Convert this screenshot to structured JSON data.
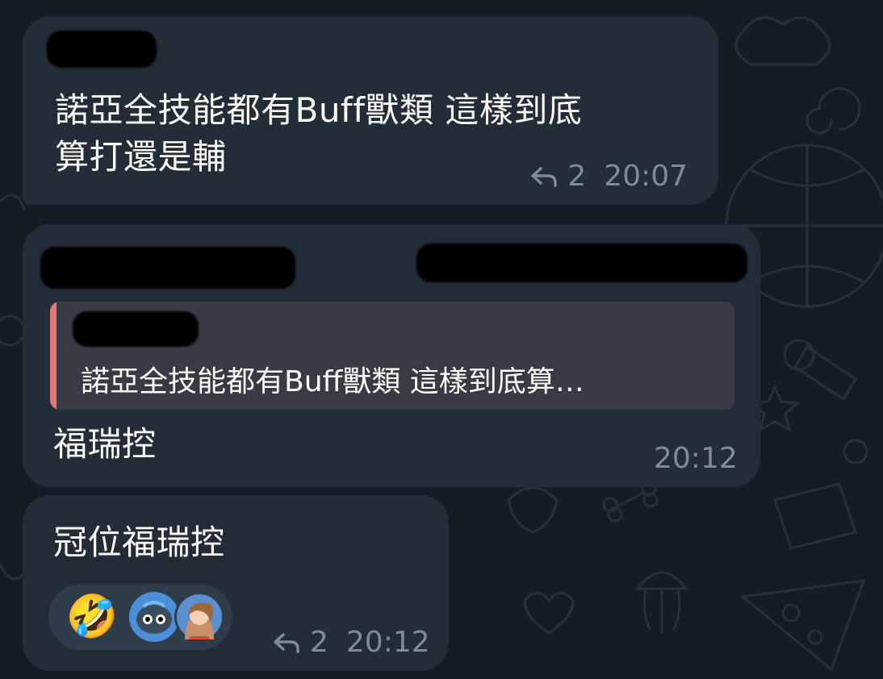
{
  "messages": [
    {
      "text_line1": "諾亞全技能都有Buff獸類 這樣到底",
      "text_line2": "算打還是輔",
      "reply_count": "2",
      "time": "20:07"
    },
    {
      "quote_text": "諾亞全技能都有Buff獸類 這樣到底算…",
      "text": "福瑞控",
      "time": "20:12"
    },
    {
      "text": "冠位福瑞控",
      "reactions": [
        {
          "icon": "rolling-laughing-emoji-icon",
          "glyph": "🤣"
        },
        {
          "icon": "blue-blob-sticker-icon"
        },
        {
          "icon": "user-avatar-icon"
        }
      ],
      "reply_count": "2",
      "time": "20:12"
    }
  ],
  "colors": {
    "bubble": "#222d37",
    "quote_bg": "#3a3a45",
    "quote_bar": "#e07a70",
    "meta": "#7e8b98",
    "reactions_pill": "#2f3d4b"
  }
}
